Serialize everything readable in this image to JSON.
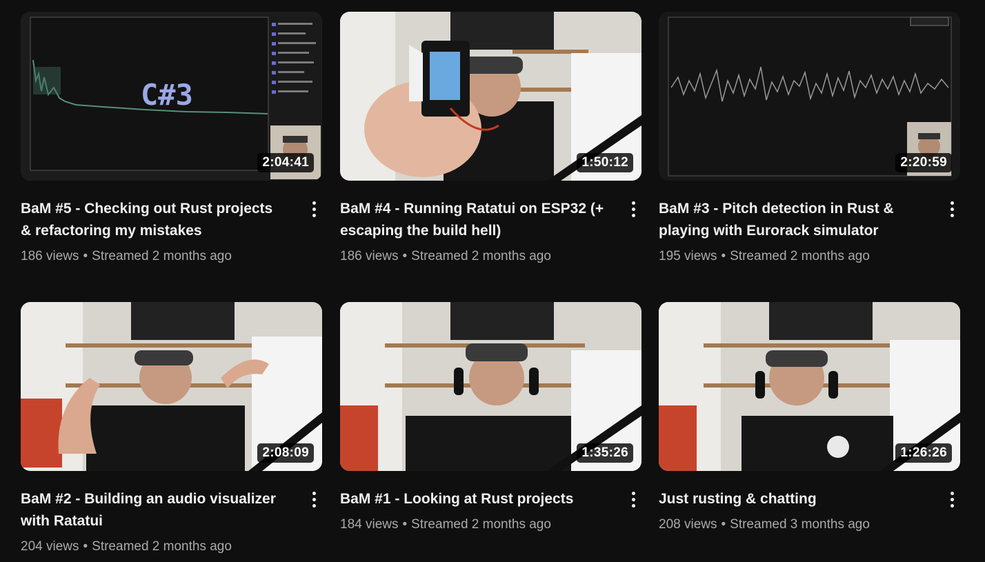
{
  "videos": [
    {
      "title": "BaM #5 - Checking out Rust projects & refactoring my mistakes",
      "views": "186 views",
      "time": "Streamed 2 months ago",
      "duration": "2:04:41",
      "thumb_text": "C#3"
    },
    {
      "title": "BaM #4 - Running Ratatui on ESP32 (+ escaping the build hell)",
      "views": "186 views",
      "time": "Streamed 2 months ago",
      "duration": "1:50:12"
    },
    {
      "title": "BaM #3 - Pitch detection in Rust & playing with Eurorack simulator",
      "views": "195 views",
      "time": "Streamed 2 months ago",
      "duration": "2:20:59"
    },
    {
      "title": "BaM #2 - Building an audio visualizer with Ratatui",
      "views": "204 views",
      "time": "Streamed 2 months ago",
      "duration": "2:08:09"
    },
    {
      "title": "BaM #1 - Looking at Rust projects",
      "views": "184 views",
      "time": "Streamed 2 months ago",
      "duration": "1:35:26"
    },
    {
      "title": "Just rusting & chatting",
      "views": "208 views",
      "time": "Streamed 3 months ago",
      "duration": "1:26:26"
    }
  ],
  "separator": "•",
  "icons": {
    "more": "more-vert-icon"
  },
  "colors": {
    "background": "#0f0f0f",
    "title": "#f1f1f1",
    "meta": "#aaaaaa"
  }
}
